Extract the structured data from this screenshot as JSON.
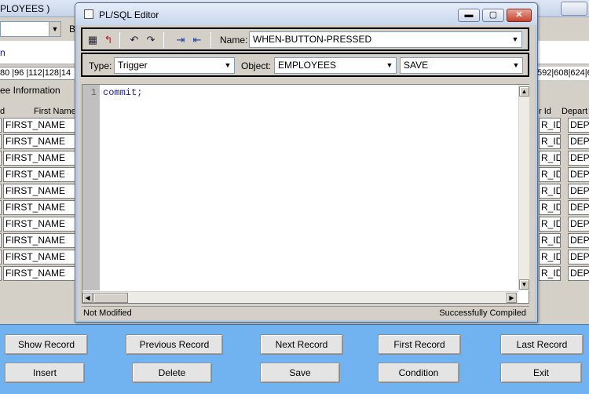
{
  "background": {
    "title_fragment": "PLOYEES )",
    "b_label": "B",
    "ruler_left": "80 |96 |112|128|14",
    "ruler_right": "592|608|624|6",
    "section_label": "ee Information",
    "header_d": "d",
    "header_first": "First Name",
    "header_r": "r Id",
    "header_depart": "Depart",
    "rows_first": [
      "FIRST_NAME",
      "FIRST_NAME",
      "FIRST_NAME",
      "FIRST_NAME",
      "FIRST_NAME",
      "FIRST_NAME",
      "FIRST_NAME",
      "FIRST_NAME",
      "FIRST_NAME",
      "FIRST_NAME"
    ],
    "rows_r": [
      "R_ID",
      "R_ID",
      "R_ID",
      "R_ID",
      "R_ID",
      "R_ID",
      "R_ID",
      "R_ID",
      "R_ID",
      "R_ID"
    ],
    "rows_dep": [
      "DEPA",
      "DEPA",
      "DEPA",
      "DEPA",
      "DEPA",
      "DEPA",
      "DEPA",
      "DEPA",
      "DEPA",
      "DEPA"
    ]
  },
  "editor": {
    "title": "PL/SQL Editor",
    "name_label": "Name:",
    "name_value": "WHEN-BUTTON-PRESSED",
    "type_label": "Type:",
    "type_value": "Trigger",
    "object_label": "Object:",
    "object_value": "EMPLOYEES",
    "sub_object_value": "SAVE",
    "line_number": "1",
    "code": "commit;",
    "status_left": "Not Modified",
    "status_right": "Successfully Compiled",
    "icons": [
      "compile-icon",
      "revert-icon",
      "undo-icon",
      "redo-icon",
      "indent-icon",
      "outdent-icon"
    ]
  },
  "buttons": {
    "row1": [
      "Show Record",
      "Previous Record",
      "Next Record",
      "First Record",
      "Last Record"
    ],
    "row2": [
      "Insert",
      "Delete",
      "Save",
      "Condition",
      "Exit"
    ]
  },
  "colors": {
    "button_panel": "#71b3f0",
    "code_keyword": "#1a1aa8",
    "close_button": "#c4452f"
  }
}
